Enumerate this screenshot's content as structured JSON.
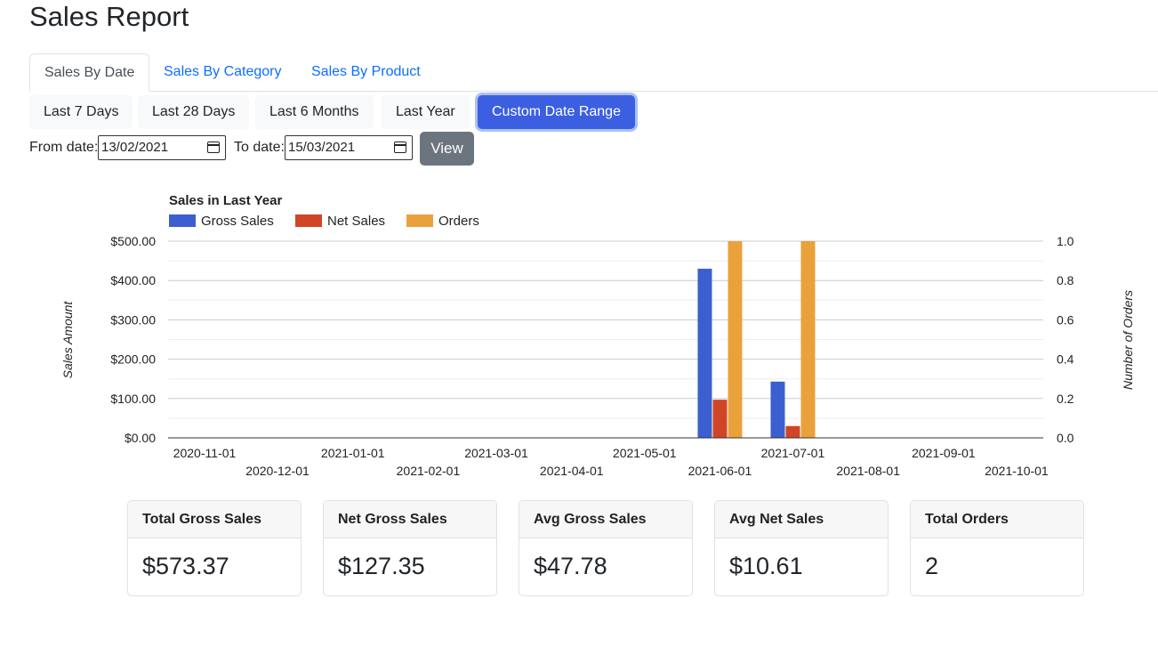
{
  "page": {
    "title": "Sales Report"
  },
  "tabs": [
    {
      "label": "Sales By Date",
      "active": true
    },
    {
      "label": "Sales By Category",
      "active": false
    },
    {
      "label": "Sales By Product",
      "active": false
    }
  ],
  "ranges": [
    {
      "label": "Last 7 Days",
      "active": false
    },
    {
      "label": "Last 28 Days",
      "active": false
    },
    {
      "label": "Last 6 Months",
      "active": false
    },
    {
      "label": "Last Year",
      "active": false
    },
    {
      "label": "Custom Date Range",
      "active": true
    }
  ],
  "filter": {
    "from_label": "From date:",
    "from_value": "13/02/2021",
    "to_label": "To date:",
    "to_value": "15/03/2021",
    "view_label": "View"
  },
  "chart_data": {
    "type": "bar",
    "title": "Sales in Last Year",
    "ylabel": "Sales Amount",
    "y2label": "Number of Orders",
    "ylim": [
      0,
      500
    ],
    "y2lim": [
      0,
      1
    ],
    "y_ticks": [
      "$0.00",
      "$100.00",
      "$200.00",
      "$300.00",
      "$400.00",
      "$500.00"
    ],
    "y2_ticks": [
      "0.0",
      "0.2",
      "0.4",
      "0.6",
      "0.8",
      "1.0"
    ],
    "x_ticks": [
      "2020-11-01",
      "2020-12-01",
      "2021-01-01",
      "2021-02-01",
      "2021-03-01",
      "2021-04-01",
      "2021-05-01",
      "2021-06-01",
      "2021-07-01",
      "2021-08-01",
      "2021-09-01",
      "2021-10-01"
    ],
    "legend_position": "top-left",
    "grid": true,
    "series": [
      {
        "name": "Gross Sales",
        "color": "#3b5fcf",
        "axis": "left",
        "points": [
          {
            "x": "2021-06-01",
            "y": 430
          },
          {
            "x": "2021-07-01",
            "y": 143
          }
        ]
      },
      {
        "name": "Net Sales",
        "color": "#d04525",
        "axis": "left",
        "points": [
          {
            "x": "2021-06-01",
            "y": 97
          },
          {
            "x": "2021-07-01",
            "y": 30
          }
        ]
      },
      {
        "name": "Orders",
        "color": "#e9a23b",
        "axis": "right",
        "points": [
          {
            "x": "2021-06-01",
            "y": 1
          },
          {
            "x": "2021-07-01",
            "y": 1
          }
        ]
      }
    ]
  },
  "summary": [
    {
      "label": "Total Gross Sales",
      "value": "$573.37"
    },
    {
      "label": "Net Gross Sales",
      "value": "$127.35"
    },
    {
      "label": "Avg Gross Sales",
      "value": "$47.78"
    },
    {
      "label": "Avg Net Sales",
      "value": "$10.61"
    },
    {
      "label": "Total Orders",
      "value": "2"
    }
  ]
}
